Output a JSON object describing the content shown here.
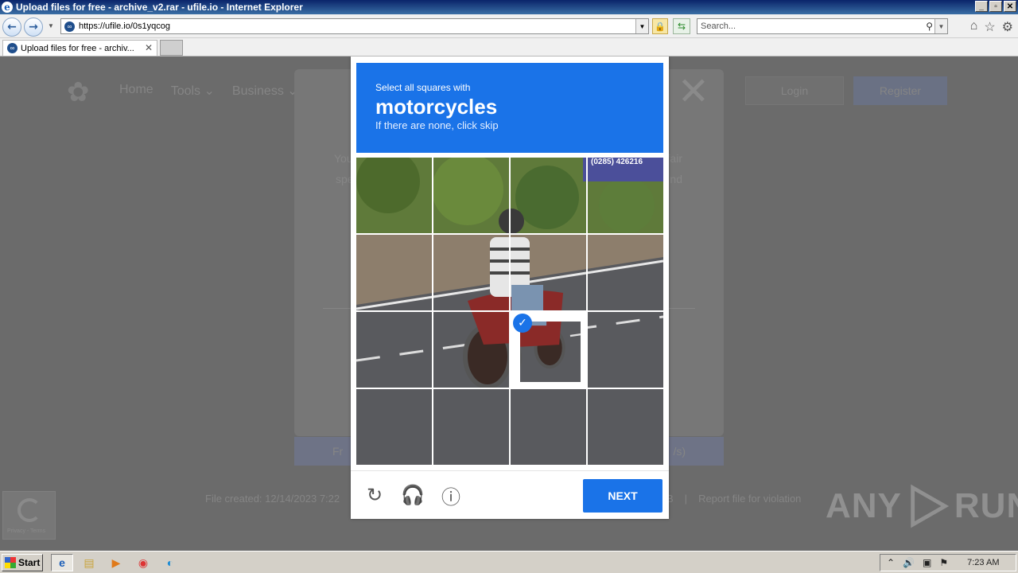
{
  "window": {
    "title": "Upload files for free - archive_v2.rar - ufile.io - Internet Explorer",
    "buttons": [
      "_",
      "▫",
      "✕"
    ]
  },
  "browser": {
    "url": "https://ufile.io/0s1yqcog",
    "search_placeholder": "Search...",
    "tab_title": "Upload files for free - archiv..."
  },
  "site": {
    "nav": [
      "Home",
      "Tools ⌄",
      "Business ⌄"
    ],
    "login": "Login",
    "register": "Register",
    "modal_text_left_1": "You",
    "modal_text_left_2": "spe",
    "modal_text_right_1": "fair",
    "modal_text_right_2": "nd",
    "download_left": "Fr",
    "download_right": "/s)",
    "footer_created": "File created: 12/14/2023 7:22",
    "footer_size": "B",
    "footer_sep": "|",
    "footer_report": "Report file for violation",
    "recaptcha_badge": "Privacy - Terms"
  },
  "captcha": {
    "instruction": "Select all squares with",
    "target": "motorcycles",
    "hint": "If there are none, click skip",
    "selected_tiles": [
      10
    ],
    "next_label": "NEXT",
    "sign_text": "(0285) 426216"
  },
  "watermark": {
    "left": "ANY",
    "right": "RUN"
  },
  "taskbar": {
    "start": "Start",
    "time": "7:23 AM"
  },
  "colors": {
    "accent": "#1a73e8",
    "overlay": "#6b6b6b"
  }
}
